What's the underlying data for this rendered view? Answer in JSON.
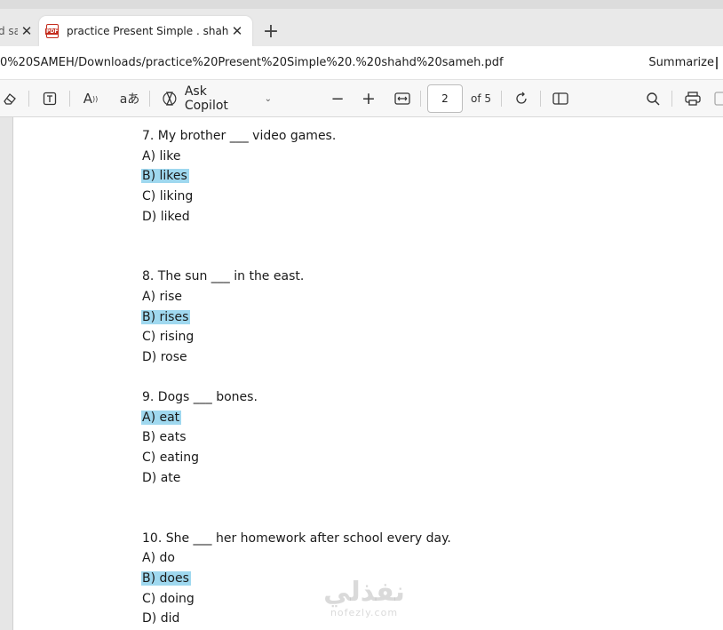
{
  "browser": {
    "tabs": [
      {
        "title": "d sa",
        "active": false
      },
      {
        "title": "practice Present Simple . shahd sa",
        "active": true
      }
    ],
    "url": "0%20SAMEH/Downloads/practice%20Present%20Simple%20.%20shahd%20sameh.pdf",
    "summarize_label": "Summarize"
  },
  "pdf_toolbar": {
    "copilot_label": "Ask Copilot",
    "current_page": "2",
    "page_of": "of 5",
    "icons": [
      "eraser-icon",
      "text-box-icon",
      "read-aloud-icon",
      "translate-icon",
      "copilot-icon",
      "zoom-out-icon",
      "zoom-in-icon",
      "fit-width-icon",
      "rotate-icon",
      "page-view-icon",
      "search-icon",
      "print-icon",
      "save-icon"
    ]
  },
  "document": {
    "questions": [
      {
        "prompt": "7. My brother ___ video games.",
        "options": [
          "A) like",
          "B) likes",
          "C) liking",
          "D) liked"
        ],
        "answer_index": 1
      },
      {
        "prompt": "8. The sun ___ in the east.",
        "options": [
          "A) rise",
          "B) rises",
          "C) rising",
          "D) rose"
        ],
        "answer_index": 1
      },
      {
        "prompt": "9. Dogs ___ bones.",
        "options": [
          "A) eat",
          "B) eats",
          "C) eating",
          "D) ate"
        ],
        "answer_index": 0
      },
      {
        "prompt": "10. She ___ her homework after school every day.",
        "options": [
          "A) do",
          "B) does",
          "C) doing",
          "D) did"
        ],
        "answer_index": 1
      }
    ],
    "highlight_color": "#9fd8ef"
  },
  "watermark": {
    "arabic": "نفذلي",
    "latin": "nofezly.com"
  }
}
